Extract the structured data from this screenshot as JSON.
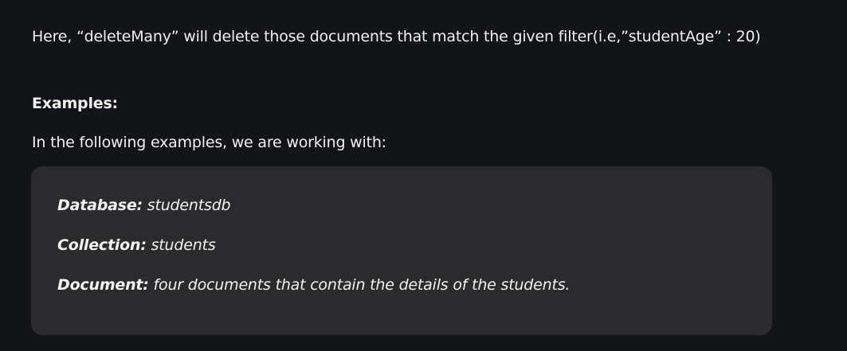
{
  "intro_text": " Here, “deleteMany” will delete those documents that match the given filter(i.e,”studentAge” : 20)",
  "examples_heading": "Examples:",
  "working_with_text": "In the following examples, we are working with:",
  "info_box": {
    "database_label": "Database:",
    "database_value": " studentsdb",
    "collection_label": "Collection:",
    "collection_value": " students",
    "document_label": "Document:",
    "document_value": " four documents that contain the details of the students."
  }
}
